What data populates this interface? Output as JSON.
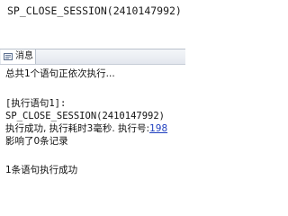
{
  "editor": {
    "statement": "SP_CLOSE_SESSION(2410147992)"
  },
  "messages_tab": {
    "label": "消息",
    "icon": "message-icon"
  },
  "messages": {
    "summary": "总共1个语句正依次执行...",
    "exec_header": "[执行语句1]:",
    "exec_statement": "SP_CLOSE_SESSION(2410147992)",
    "exec_result_prefix": "执行成功, 执行耗时3毫秒. 执行号:",
    "exec_number": "198",
    "affected_rows": "影响了0条记录",
    "final_status": "1条语句执行成功"
  }
}
